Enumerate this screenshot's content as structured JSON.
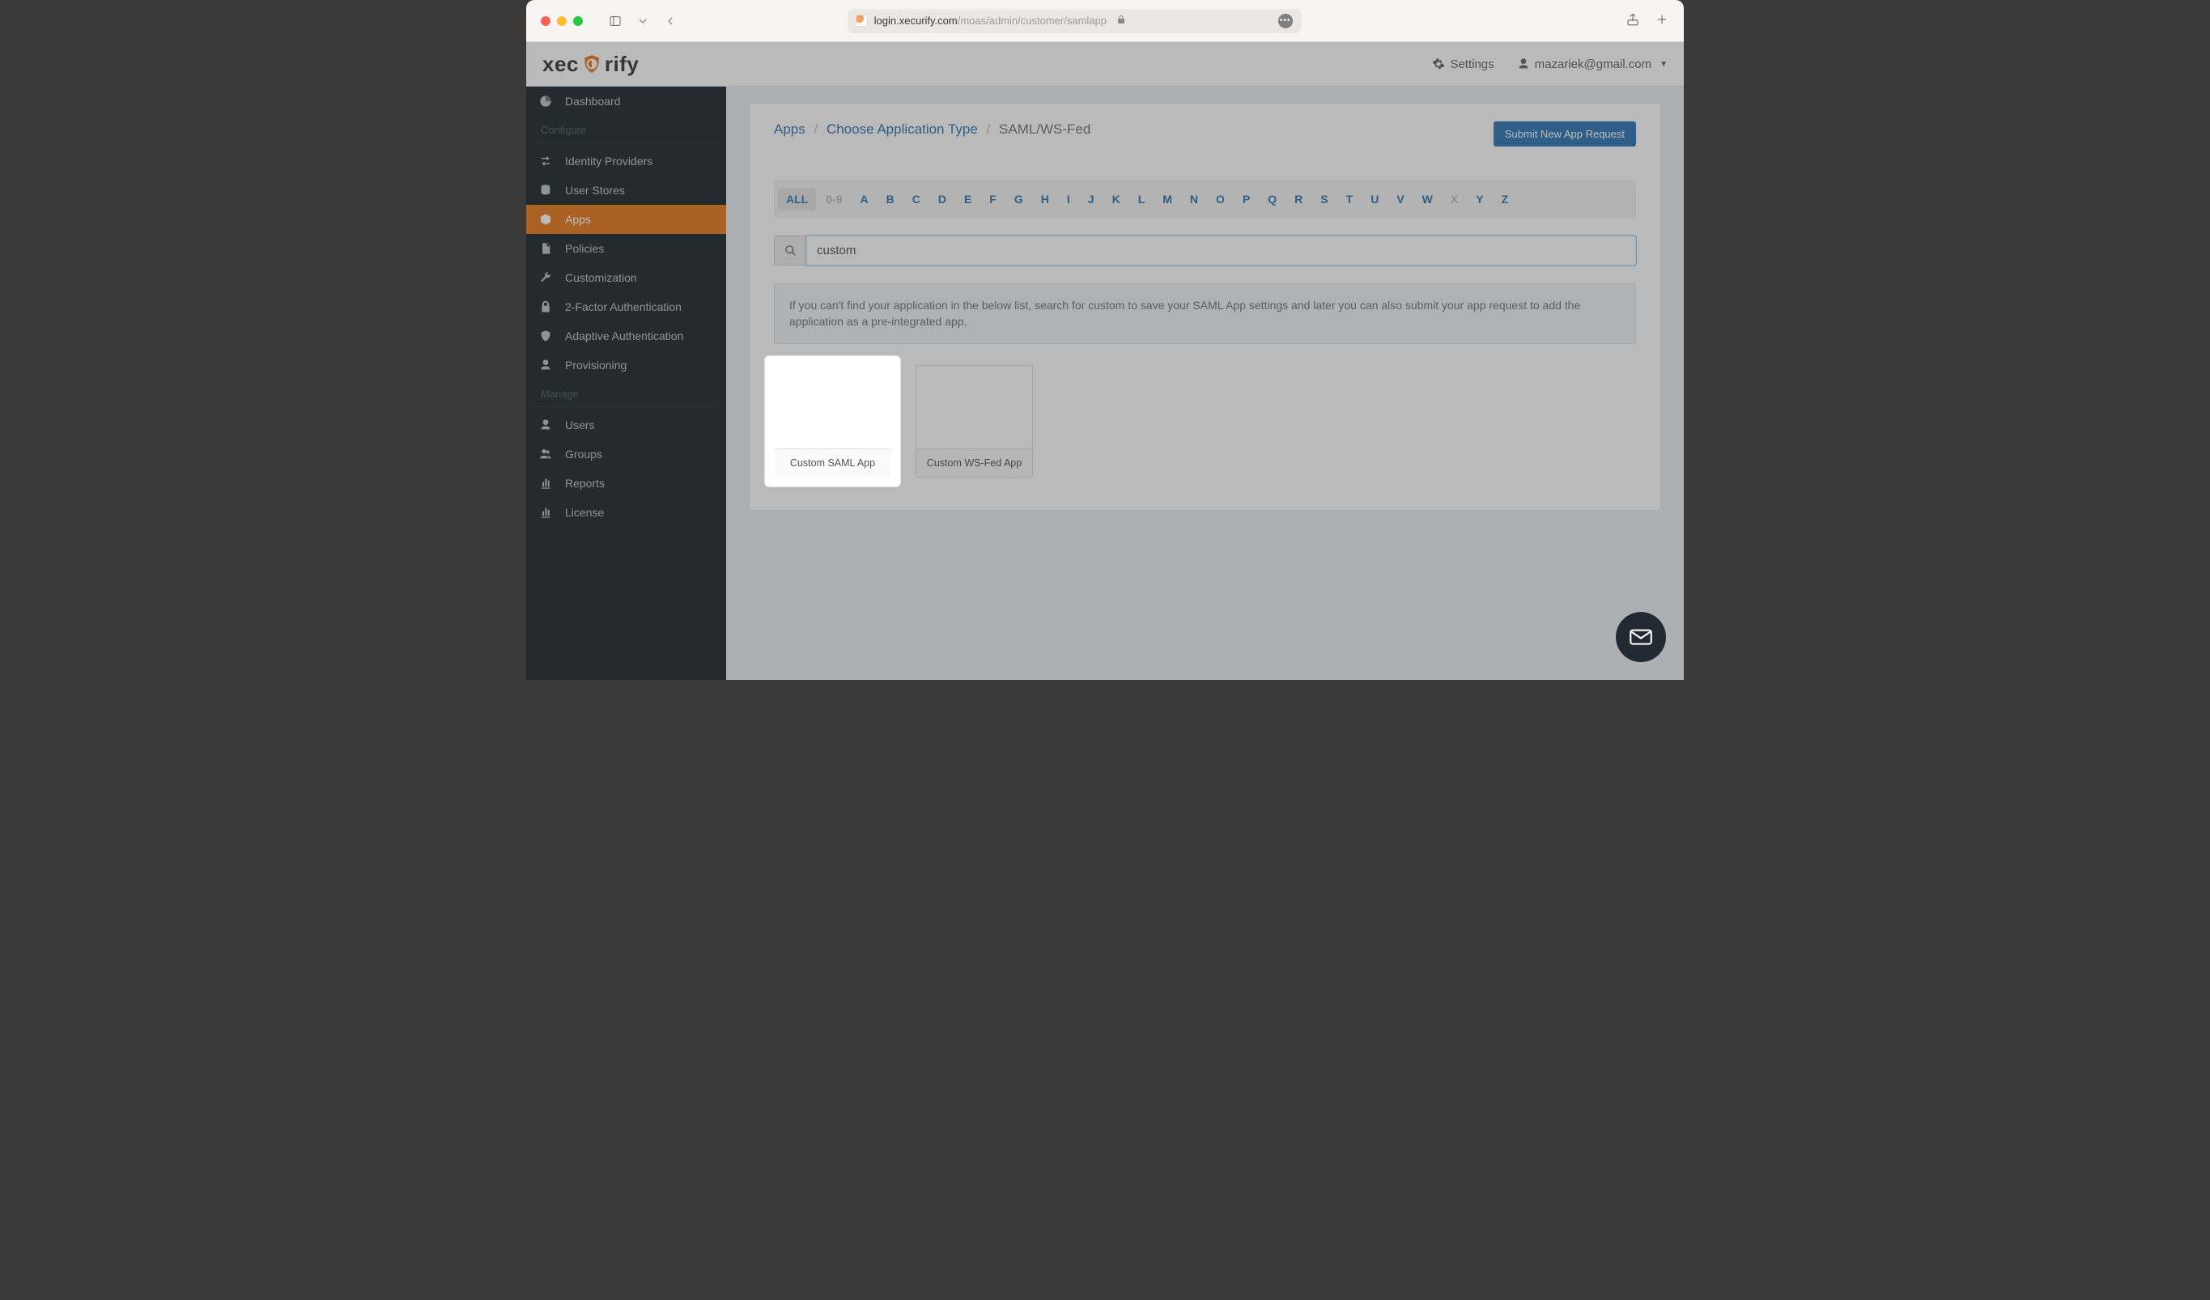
{
  "browser": {
    "url_host": "login.xecurify.com",
    "url_path": "/moas/admin/customer/samlapp"
  },
  "header": {
    "settings_label": "Settings",
    "user_email": "mazariek@gmail.com"
  },
  "logo": {
    "pre": "xec",
    "post": "rify"
  },
  "sidebar": {
    "configure_label": "Configure",
    "manage_label": "Manage",
    "configure_items": [
      {
        "icon": "dashboard",
        "label": "Dashboard"
      },
      {
        "icon": "swap",
        "label": "Identity Providers"
      },
      {
        "icon": "db",
        "label": "User Stores"
      },
      {
        "icon": "cube",
        "label": "Apps",
        "active": true
      },
      {
        "icon": "doc",
        "label": "Policies"
      },
      {
        "icon": "wrench",
        "label": "Customization"
      },
      {
        "icon": "lock",
        "label": "2-Factor Authentication"
      },
      {
        "icon": "shield",
        "label": "Adaptive Authentication"
      },
      {
        "icon": "user",
        "label": "Provisioning"
      }
    ],
    "manage_items": [
      {
        "icon": "user",
        "label": "Users"
      },
      {
        "icon": "users",
        "label": "Groups"
      },
      {
        "icon": "chart",
        "label": "Reports"
      },
      {
        "icon": "chart",
        "label": "License"
      }
    ]
  },
  "breadcrumbs": {
    "apps": "Apps",
    "choose": "Choose Application Type",
    "current": "SAML/WS-Fed"
  },
  "actions": {
    "submit_request": "Submit New App Request"
  },
  "filters": {
    "letters": [
      "ALL",
      "0-9",
      "A",
      "B",
      "C",
      "D",
      "E",
      "F",
      "G",
      "H",
      "I",
      "J",
      "K",
      "L",
      "M",
      "N",
      "O",
      "P",
      "Q",
      "R",
      "S",
      "T",
      "U",
      "V",
      "W",
      "X",
      "Y",
      "Z"
    ],
    "active": "ALL",
    "disabled": [
      "0-9",
      "X"
    ]
  },
  "search": {
    "value": "custom",
    "placeholder": ""
  },
  "info_banner": "If you can't find your application in the below list, search for custom to save your SAML App settings and later you can also submit your app request to add the application as a pre-integrated app.",
  "tiles": [
    {
      "label": "Custom SAML App"
    },
    {
      "label": "Custom WS-Fed App"
    }
  ]
}
